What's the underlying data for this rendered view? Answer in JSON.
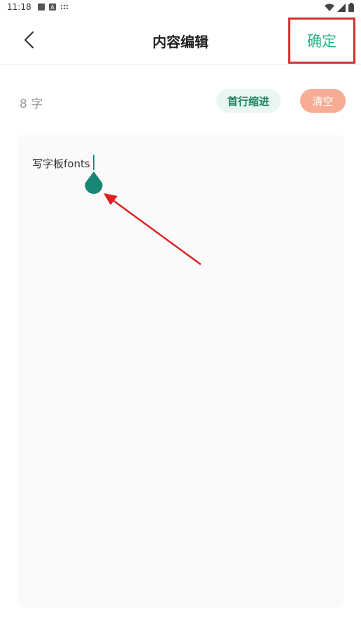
{
  "status_bar": {
    "time": "11:18"
  },
  "header": {
    "title": "内容编辑",
    "confirm_label": "确定"
  },
  "toolbar": {
    "char_count": "8 字",
    "indent_label": "首行缩进",
    "clear_label": "清空"
  },
  "editor": {
    "content": "写字板fonts"
  },
  "colors": {
    "accent": "#2ab07f",
    "indent_bg": "#eaf7f1",
    "clear_bg": "#f7ac93",
    "cursor": "#1a8a76",
    "highlight": "#d32f2f"
  }
}
